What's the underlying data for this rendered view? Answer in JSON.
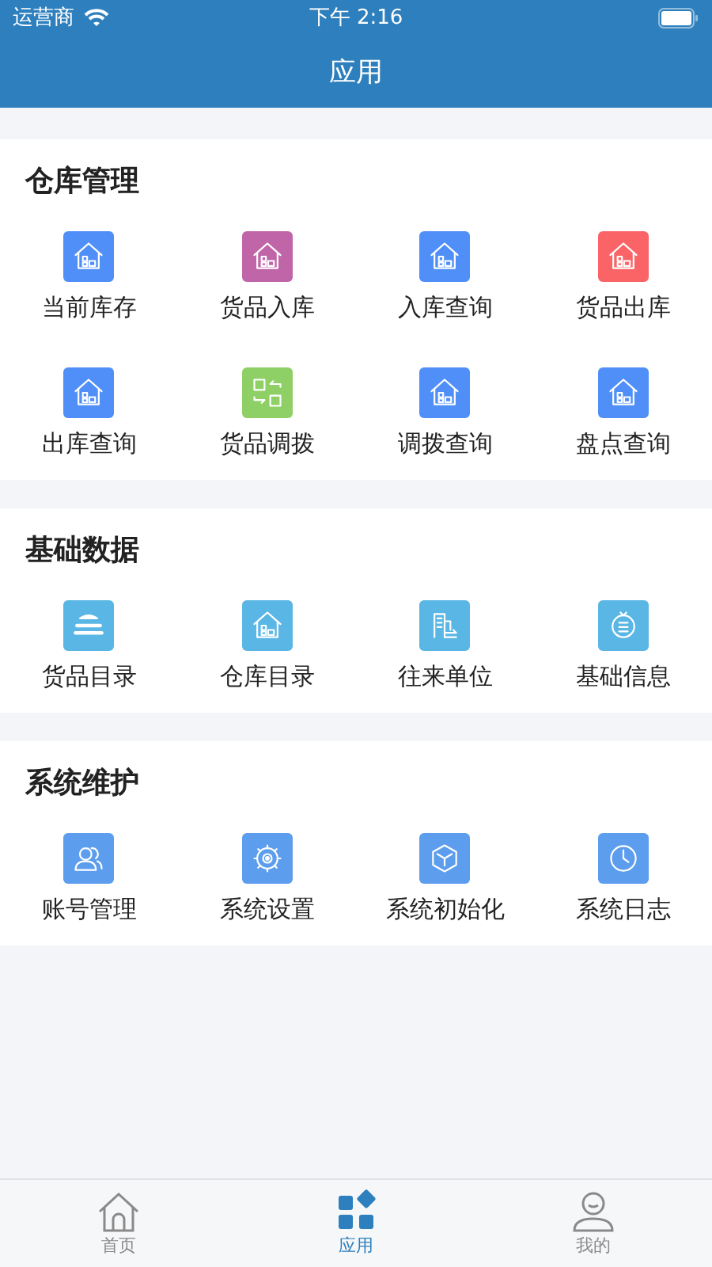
{
  "status_bar": {
    "carrier": "运营商",
    "time": "下午 2:16"
  },
  "header": {
    "title": "应用"
  },
  "sections": [
    {
      "title": "仓库管理",
      "items": [
        {
          "label": "当前库存",
          "color": "#4f8ff7"
        },
        {
          "label": "货品入库",
          "color": "#c065a8"
        },
        {
          "label": "入库查询",
          "color": "#4f8ff7"
        },
        {
          "label": "货品出库",
          "color": "#fa6466"
        },
        {
          "label": "出库查询",
          "color": "#4f8ff7"
        },
        {
          "label": "货品调拨",
          "color": "#8fd066"
        },
        {
          "label": "调拨查询",
          "color": "#4f8ff7"
        },
        {
          "label": "盘点查询",
          "color": "#4f8ff7"
        }
      ]
    },
    {
      "title": "基础数据",
      "items": [
        {
          "label": "货品目录",
          "color": "#5ab6e4"
        },
        {
          "label": "仓库目录",
          "color": "#5ab6e4"
        },
        {
          "label": "往来单位",
          "color": "#5ab6e4"
        },
        {
          "label": "基础信息",
          "color": "#5ab6e4"
        }
      ]
    },
    {
      "title": "系统维护",
      "items": [
        {
          "label": "账号管理",
          "color": "#5c9ded"
        },
        {
          "label": "系统设置",
          "color": "#5c9ded"
        },
        {
          "label": "系统初始化",
          "color": "#5c9ded"
        },
        {
          "label": "系统日志",
          "color": "#5c9ded"
        }
      ]
    }
  ],
  "tab_bar": [
    {
      "label": "首页",
      "selected": false
    },
    {
      "label": "应用",
      "selected": true
    },
    {
      "label": "我的",
      "selected": false
    }
  ]
}
